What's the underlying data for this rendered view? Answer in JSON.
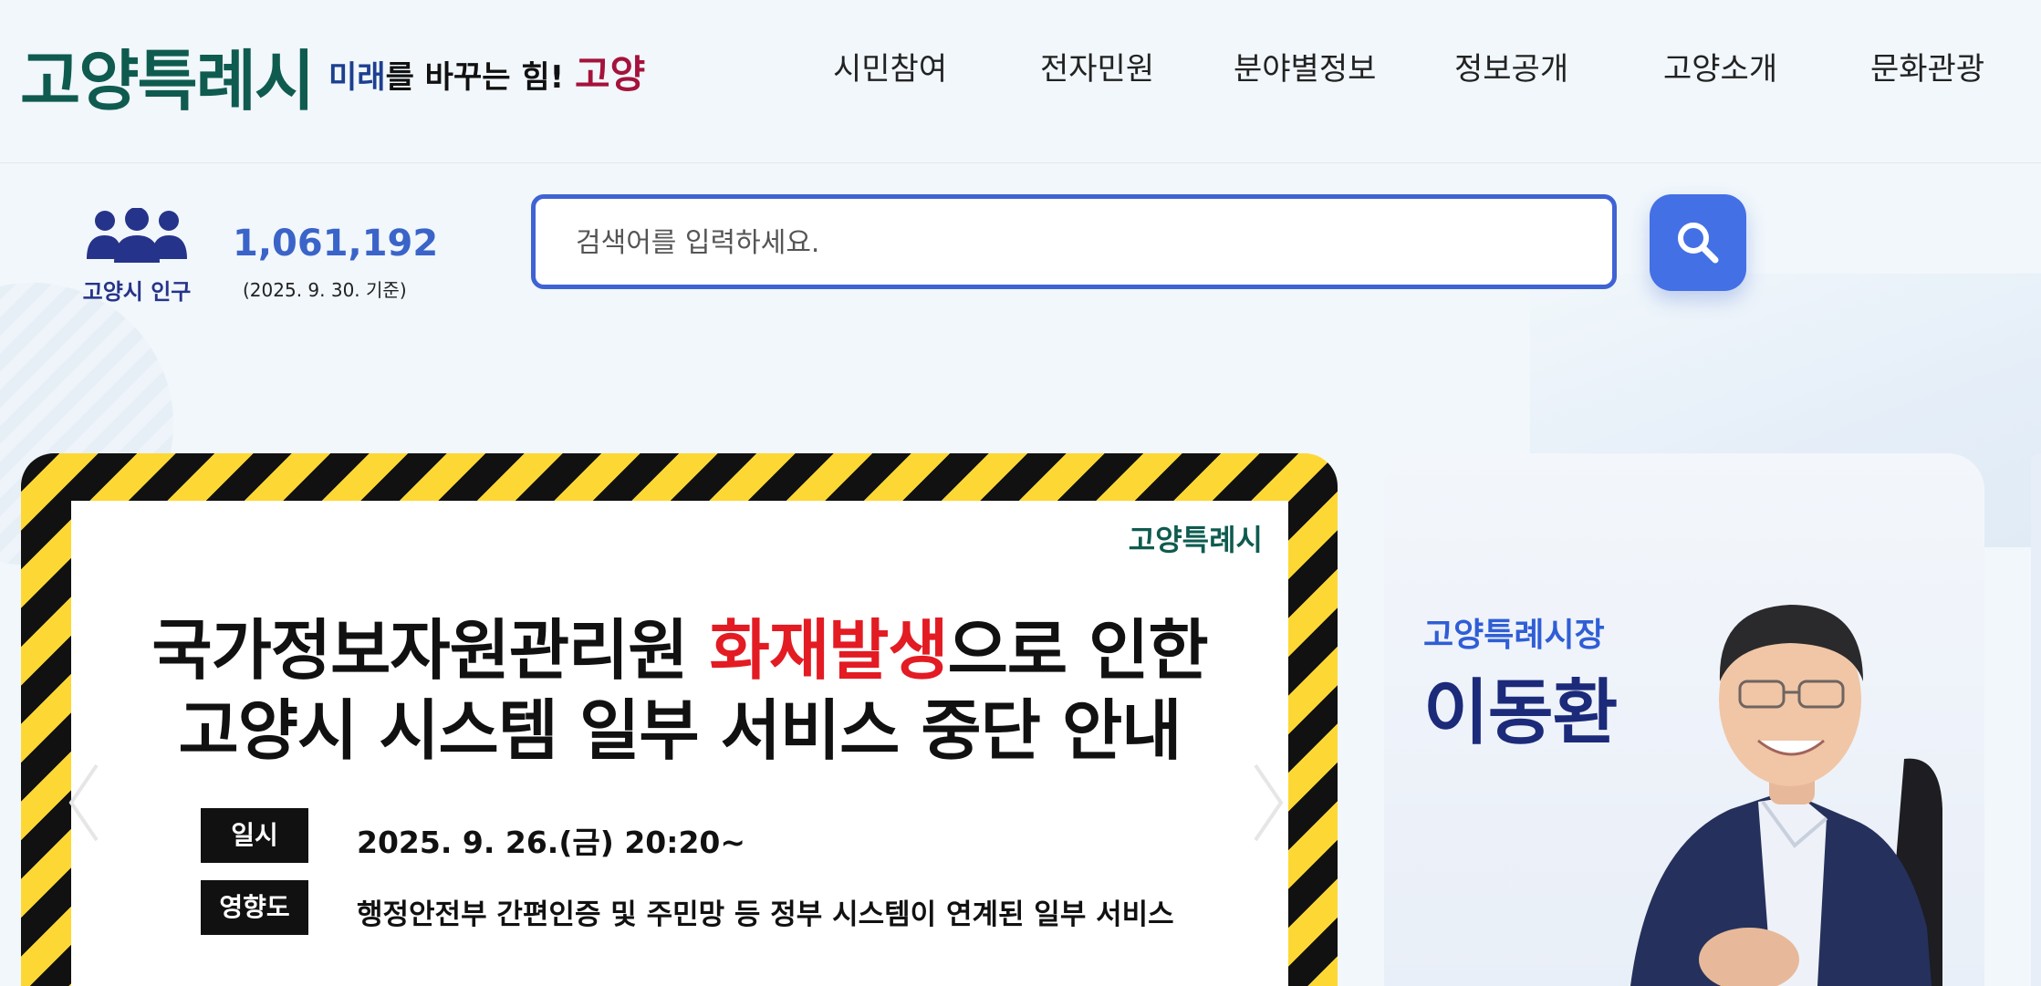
{
  "header": {
    "logo_text": "고양특례시",
    "slogan_part1": "미래",
    "slogan_part2": "를 바꾸는 힘! ",
    "slogan_part3": "고양",
    "nav": [
      "시민참여",
      "전자민원",
      "분야별정보",
      "정보공개",
      "고양소개",
      "문화관광"
    ]
  },
  "population": {
    "icon": "people-group-icon",
    "label": "고양시 인구",
    "count": "1,061,192",
    "date": "(2025. 9. 30. 기준)"
  },
  "search": {
    "placeholder": "검색어를 입력하세요.",
    "icon": "search-icon"
  },
  "banner": {
    "brand": "고양특례시",
    "title_part1": "국가정보자원관리원 ",
    "title_hot": "화재발생",
    "title_part2": "으로 인한",
    "title_line2": "고양시 시스템 일부 서비스 중단 안내",
    "date_tag": "일시",
    "date_value": "2025. 9. 26.(금) 20:20~",
    "impact_tag": "영향도",
    "impact_value": "행정안전부 간편인증 및 주민망 등 정부 시스템이 연계된 일부 서비스"
  },
  "mayor": {
    "title": "고양특례시장",
    "name": "이동환"
  },
  "colors": {
    "brand_green": "#0f5b50",
    "accent_blue": "#4470e6",
    "warning_yellow": "#fdd835",
    "alert_red": "#e31b23",
    "navy": "#1c2a7a"
  }
}
